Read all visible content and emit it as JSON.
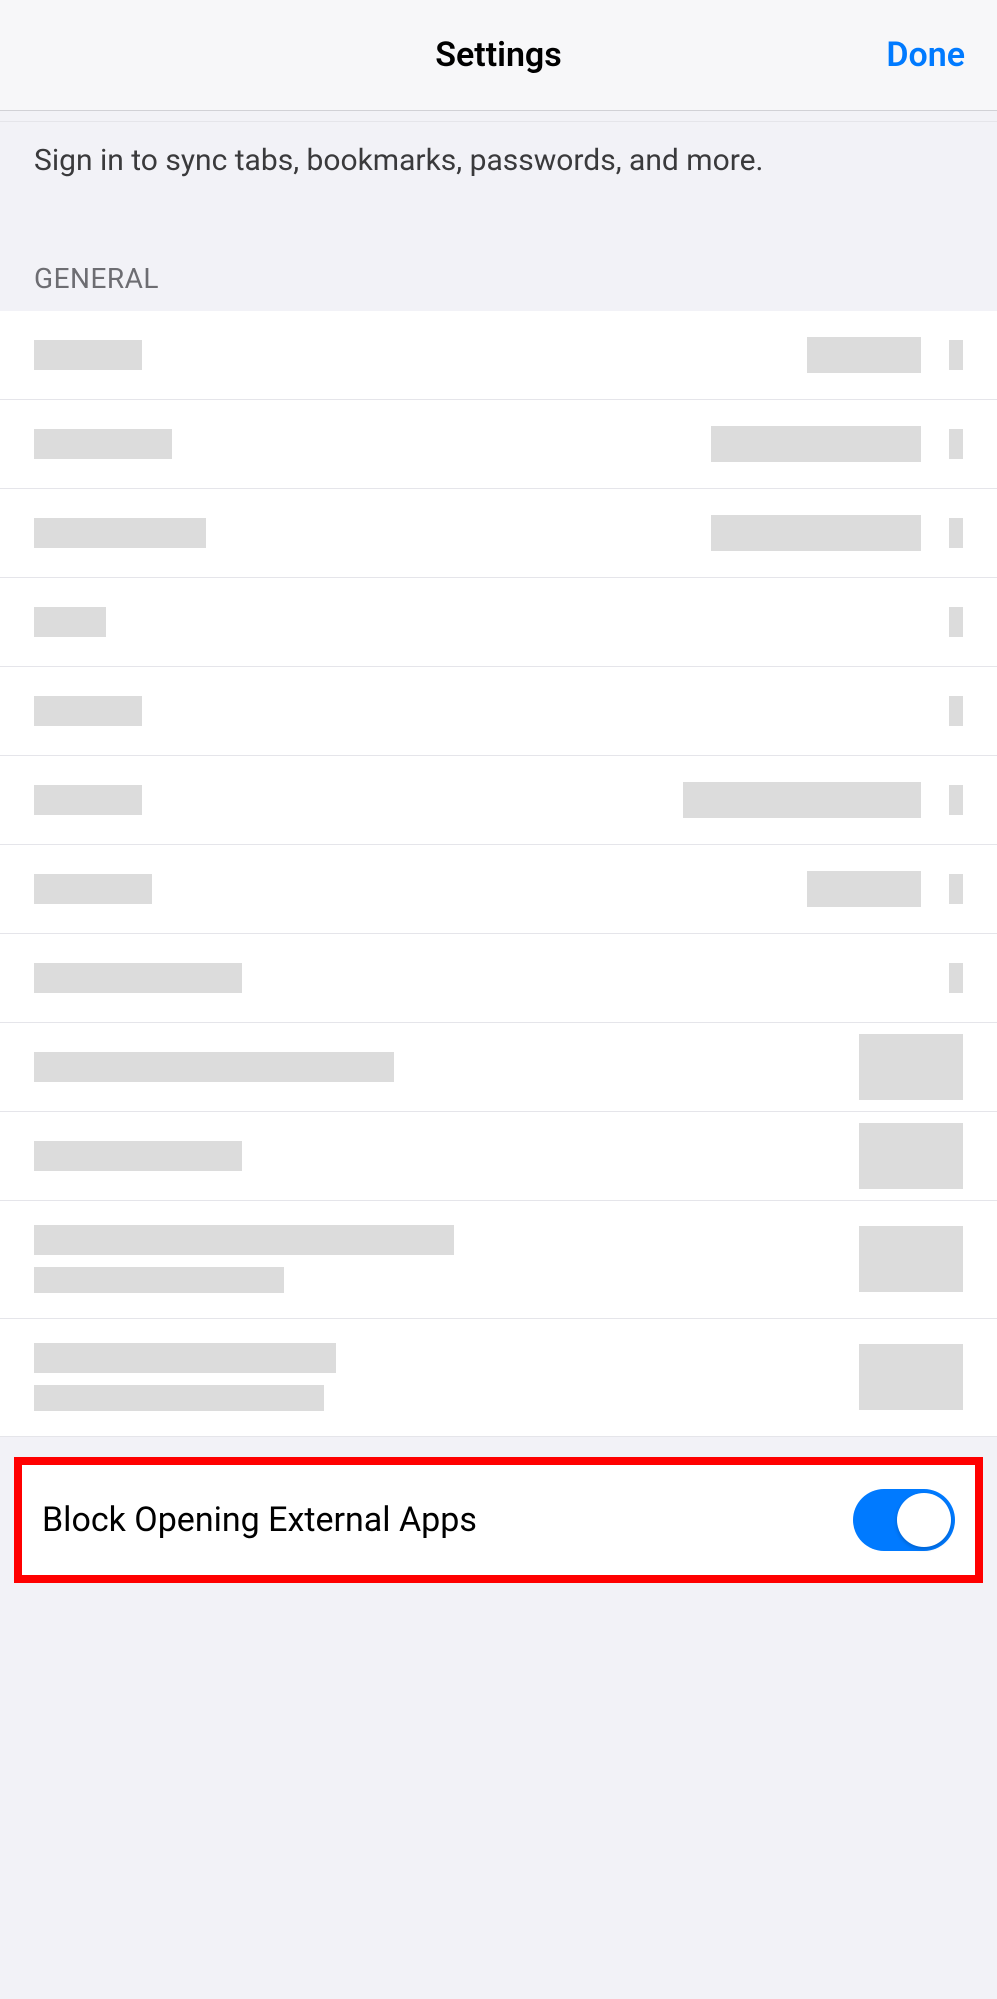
{
  "header": {
    "title": "Settings",
    "done": "Done"
  },
  "signin": {
    "text": "Sign in to sync tabs, bookmarks, passwords, and more."
  },
  "section": {
    "general": "GENERAL"
  },
  "rows": [
    {
      "label_w": 108,
      "value_w": 114,
      "has_chevron": true,
      "type": "nav"
    },
    {
      "label_w": 138,
      "value_w": 210,
      "has_chevron": true,
      "type": "nav"
    },
    {
      "label_w": 172,
      "value_w": 210,
      "has_chevron": true,
      "type": "nav"
    },
    {
      "label_w": 72,
      "value_w": 0,
      "has_chevron": true,
      "type": "nav"
    },
    {
      "label_w": 108,
      "value_w": 0,
      "has_chevron": true,
      "type": "nav"
    },
    {
      "label_w": 108,
      "value_w": 238,
      "has_chevron": true,
      "type": "nav"
    },
    {
      "label_w": 118,
      "value_w": 114,
      "has_chevron": true,
      "type": "nav"
    },
    {
      "label_w": 208,
      "value_w": 0,
      "has_chevron": true,
      "type": "nav"
    },
    {
      "label_w": 360,
      "value_w": 0,
      "has_chevron": false,
      "type": "toggle"
    },
    {
      "label_w": 208,
      "value_w": 0,
      "has_chevron": false,
      "type": "toggle"
    },
    {
      "label_w": 420,
      "label2_w": 250,
      "value_w": 0,
      "has_chevron": false,
      "type": "toggle",
      "two_line": true
    },
    {
      "label_w": 302,
      "label2_w": 290,
      "value_w": 0,
      "has_chevron": false,
      "type": "toggle",
      "two_line": true
    }
  ],
  "highlighted": {
    "label": "Block Opening External Apps",
    "state": "on"
  }
}
